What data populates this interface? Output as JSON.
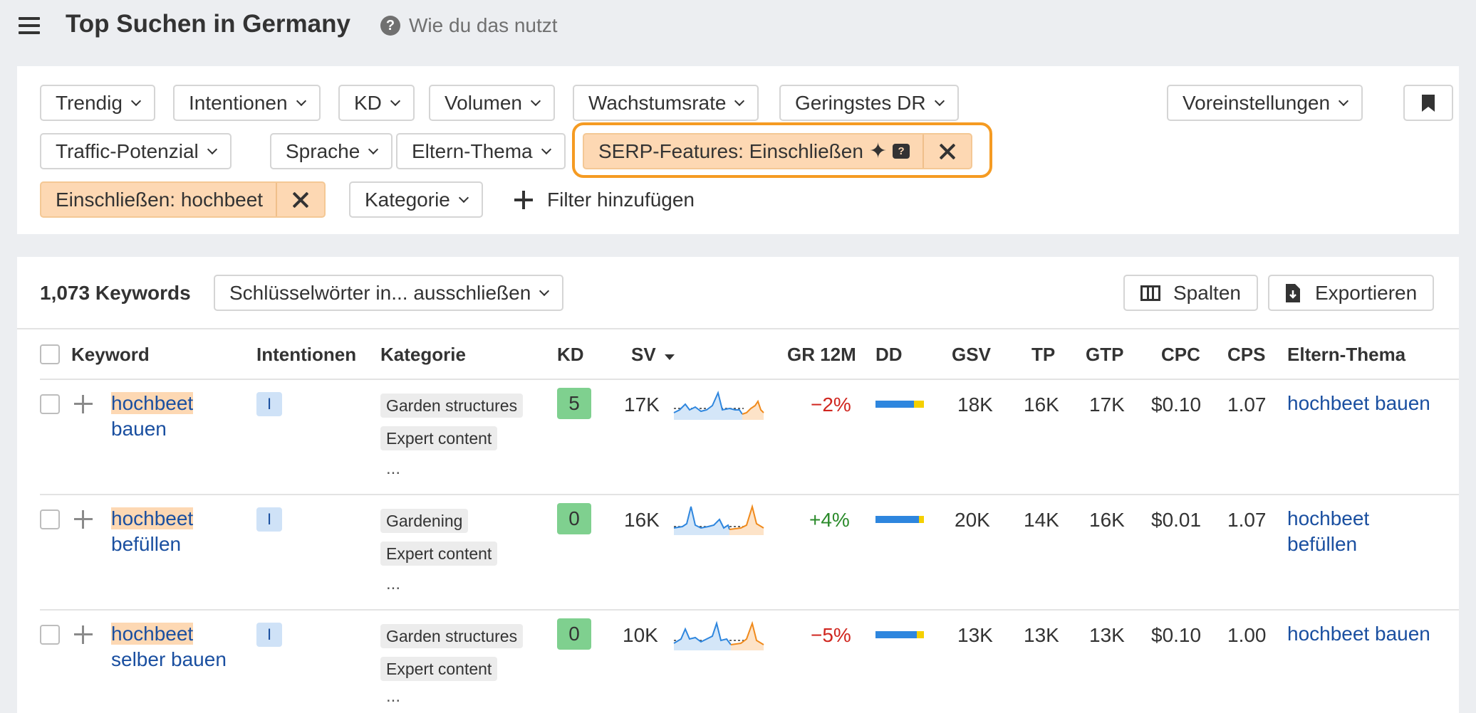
{
  "header": {
    "title": "Top Suchen in Germany",
    "help_label": "Wie du das nutzt"
  },
  "filters": {
    "row1": [
      "Trendig",
      "Intentionen",
      "KD",
      "Volumen",
      "Wachstumsrate",
      "Geringstes DR"
    ],
    "row2": [
      "Traffic-Potenzial",
      "Sprache",
      "Eltern-Thema"
    ],
    "serp_active": "SERP-Features: Einschließen",
    "include_active": "Einschließen: hochbeet",
    "category": "Kategorie",
    "add_filter": "Filter hinzufügen",
    "presets": "Voreinstellungen"
  },
  "results": {
    "count": "1,073 Keywords",
    "exclude_dropdown": "Schlüsselwörter in... ausschließen",
    "columns_btn": "Spalten",
    "export_btn": "Exportieren",
    "headers": {
      "keyword": "Keyword",
      "intent": "Intentionen",
      "category": "Kategorie",
      "kd": "KD",
      "sv": "SV",
      "gr": "GR 12M",
      "dd": "DD",
      "gsv": "GSV",
      "tp": "TP",
      "gtp": "GTP",
      "cpc": "CPC",
      "cps": "CPS",
      "parent": "Eltern-Thema"
    },
    "rows": [
      {
        "kw_hl": "hochbeet",
        "kw_rest": "bauen",
        "intent": "I",
        "tags": [
          "Garden structures",
          "Expert content"
        ],
        "more": "...",
        "kd": "5",
        "sv": "17K",
        "gr": "−2%",
        "dd": 0.79,
        "gsv": "18K",
        "tp": "16K",
        "gtp": "17K",
        "cpc": "$0.10",
        "cps": "1.07",
        "parent_1": "hochbeet bauen",
        "parent_2": ""
      },
      {
        "kw_hl": "hochbeet",
        "kw_rest": "befüllen",
        "intent": "I",
        "tags": [
          "Gardening",
          "Expert content"
        ],
        "more": "...",
        "kd": "0",
        "sv": "16K",
        "gr": "+4%",
        "dd": 0.9,
        "gsv": "20K",
        "tp": "14K",
        "gtp": "16K",
        "cpc": "$0.01",
        "cps": "1.07",
        "parent_1": "hochbeet",
        "parent_2": "befüllen"
      },
      {
        "kw_hl": "hochbeet",
        "kw_rest": "selber bauen",
        "intent": "I",
        "tags": [
          "Garden structures",
          "Expert content"
        ],
        "more": "...",
        "kd": "0",
        "sv": "10K",
        "gr": "−5%",
        "dd": 0.85,
        "gsv": "13K",
        "tp": "13K",
        "gtp": "13K",
        "cpc": "$0.10",
        "cps": "1.00",
        "parent_1": "hochbeet bauen",
        "parent_2": ""
      }
    ]
  },
  "colors": {
    "link": "#1a4fa0",
    "active_filter": "#fdd8b3",
    "highlight_ring": "#f59b22",
    "kd_green": "#7fd08f",
    "negative": "#d0261f",
    "positive": "#2a8a2a",
    "spark_blue": "#2e86de",
    "spark_orange": "#f08a1c"
  }
}
